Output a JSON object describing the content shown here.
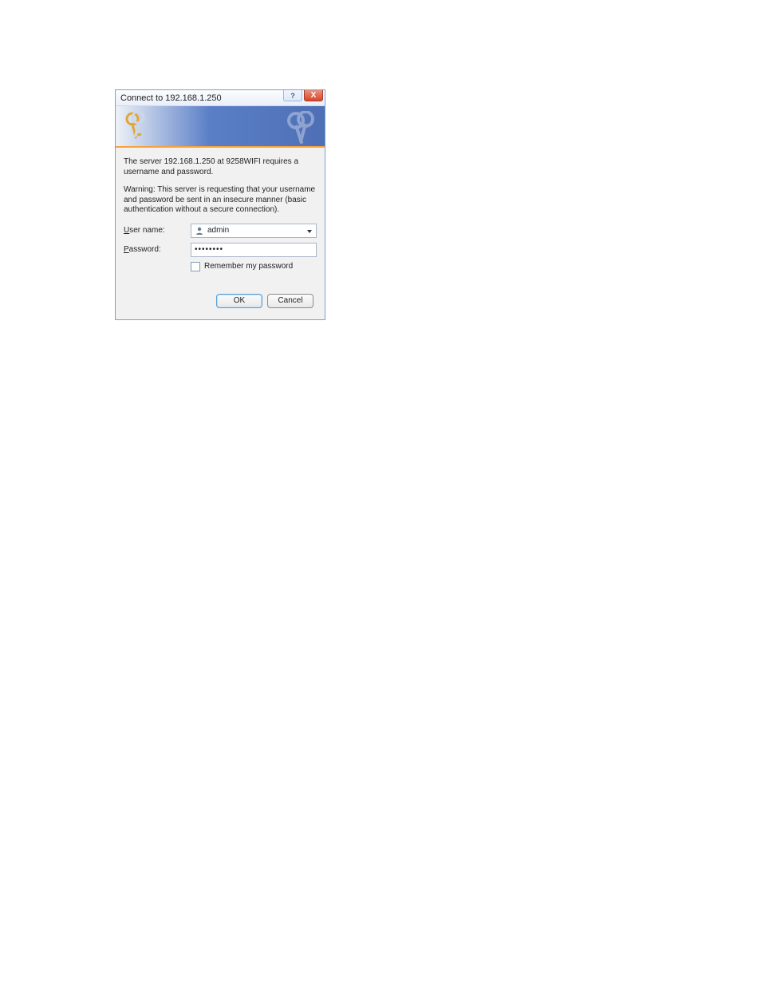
{
  "titlebar": {
    "title": "Connect to 192.168.1.250",
    "help_label": "?",
    "close_label": "X"
  },
  "messages": {
    "line1": "The server 192.168.1.250 at 9258WIFI requires a username and password.",
    "line2": "Warning: This server is requesting that your username and password be sent in an insecure manner (basic authentication without a secure connection)."
  },
  "form": {
    "username_label_prefix": "U",
    "username_label_rest": "ser name:",
    "username_value": "admin",
    "password_label_prefix": "P",
    "password_label_rest": "assword:",
    "password_value": "••••••••",
    "remember_prefix": "R",
    "remember_rest": "emember my password"
  },
  "buttons": {
    "ok": "OK",
    "cancel": "Cancel"
  }
}
